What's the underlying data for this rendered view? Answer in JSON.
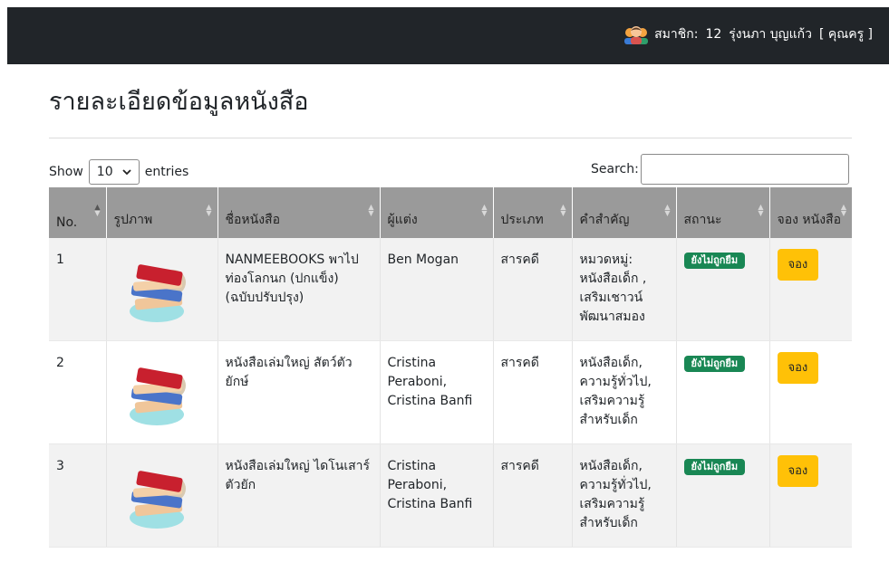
{
  "header": {
    "member_label": "สมาชิก:",
    "member_id": "12",
    "member_name": "รุ่งนภา บุญแก้ว",
    "member_role": "[ คุณครู ]"
  },
  "page": {
    "title": "รายละเอียดข้อมูลหนังสือ"
  },
  "controls": {
    "show_label": "Show",
    "entries_value": "10",
    "entries_label": "entries",
    "search_label": "Search:"
  },
  "table": {
    "headers": [
      "No.",
      "รูปภาพ",
      "ชื่อหนังสือ",
      "ผู้แต่ง",
      "ประเภท",
      "คำสำคัญ",
      "สถานะ",
      "จอง หนังสือ"
    ],
    "rows": [
      {
        "no": "1",
        "title": "NANMEEBOOKS พาไปท่องโลกนก (ปกแข็ง) (ฉบับปรับปรุง)",
        "author": "Ben Mogan",
        "category": "สารคดี",
        "keywords": "หมวดหมู่: หนังสือเด็ก , เสริมเชาวน์ พัฒนาสมอง",
        "status": "ยังไม่ถูกยืม",
        "action": "จอง"
      },
      {
        "no": "2",
        "title": "หนังสือเล่มใหญ่ สัตว์ตัวยักษ์",
        "author": "Cristina Peraboni, Cristina Banfi",
        "category": "สารคดี",
        "keywords": "หนังสือเด็ก, ความรู้ทั่วไป, เสริมความรู้สำหรับเด็ก",
        "status": "ยังไม่ถูกยืม",
        "action": "จอง"
      },
      {
        "no": "3",
        "title": "หนังสือเล่มใหญ่ ไดโนเสาร์ตัวยัก",
        "author": "Cristina Peraboni, Cristina Banfi",
        "category": "สารคดี",
        "keywords": "หนังสือเด็ก, ความรู้ทั่วไป, เสริมความรู้สำหรับเด็ก",
        "status": "ยังไม่ถูกยืม",
        "action": "จอง"
      }
    ]
  },
  "icons": {
    "user": "users-avatar-icon",
    "book": "book-stack-icon",
    "dropdown": "chevron-down-icon"
  },
  "colors": {
    "topbar": "#212529",
    "header_bg": "#9a9a9a",
    "badge": "#198754",
    "button": "#ffc107"
  }
}
